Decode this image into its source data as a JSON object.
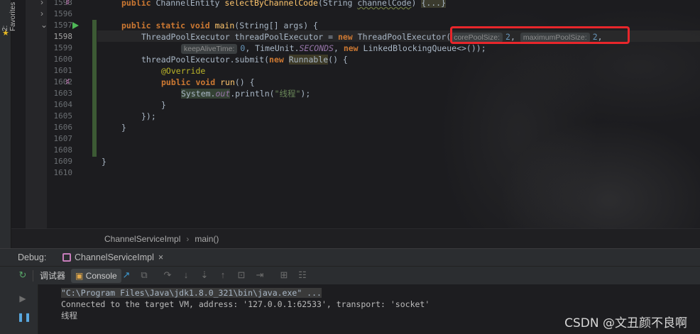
{
  "left_sidebar": {
    "favorites_label": "2: Favorites"
  },
  "editor": {
    "line_numbers": [
      "1593",
      "1596",
      "1597",
      "1598",
      "1599",
      "1600",
      "1601",
      "1602",
      "1603",
      "1604",
      "1605",
      "1606",
      "1607",
      "1608",
      "1609",
      "1610"
    ],
    "lines": {
      "l1593_a": "public ",
      "l1593_b": "ChannelEntity ",
      "l1593_c": "selectByChannelCode",
      "l1593_d": "(String ",
      "l1593_e": "channelCode",
      "l1593_f": ") ",
      "l1593_g": "{...}",
      "l1597_a": "public static void ",
      "l1597_b": "main",
      "l1597_c": "(String[] args) {",
      "l1598_a": "ThreadPoolExecutor threadPoolExecutor = ",
      "l1598_b": "new ",
      "l1598_c": "ThreadPoolExecutor(",
      "hint_core": "corePoolSize:",
      "val_core": "2",
      "hint_max": "maximumPoolSize:",
      "val_max": "2",
      "comma": ",",
      "hint_keep": "keepAliveTime:",
      "val_keep": "0",
      "l1599_b": ", TimeUnit.",
      "l1599_c": "SECONDS",
      "l1599_d": ", ",
      "l1599_e": "new ",
      "l1599_f": "LinkedBlockingQueue<>());",
      "l1600_a": "threadPoolExecutor.",
      "l1600_b": "submit",
      "l1600_c": "(",
      "l1600_d": "new ",
      "l1600_e": "Runnable",
      "l1600_f": "() {",
      "l1601": "@Override",
      "l1602_a": "public void ",
      "l1602_b": "run",
      "l1602_c": "() {",
      "l1603_a": "System.",
      "l1603_b": "out",
      "l1603_c": ".println(",
      "l1603_d": "\"线程\"",
      "l1603_e": ");",
      "l1604": "}",
      "l1605": "});",
      "l1606": "}",
      "l1609": "}"
    }
  },
  "breadcrumb": {
    "class": "ChannelServiceImpl",
    "method": "main()"
  },
  "debug": {
    "label": "Debug:",
    "tab": "ChannelServiceImpl",
    "close": "×"
  },
  "toolbar": {
    "debugger": "调试器",
    "console": "Console"
  },
  "console": {
    "cmd": "\"C:\\Program Files\\Java\\jdk1.8.0_321\\bin\\java.exe\" ...",
    "connected": "Connected to the target VM, address: '127.0.0.1:62533', transport: 'socket'",
    "output": "线程"
  },
  "watermark": "CSDN @文丑颜不良啊",
  "colors": {
    "keyword": "#cc7832",
    "function": "#ffc66d",
    "string": "#6a8759",
    "number": "#6897bb",
    "annotation": "#bbb529",
    "highlight_box": "#e8262b"
  }
}
